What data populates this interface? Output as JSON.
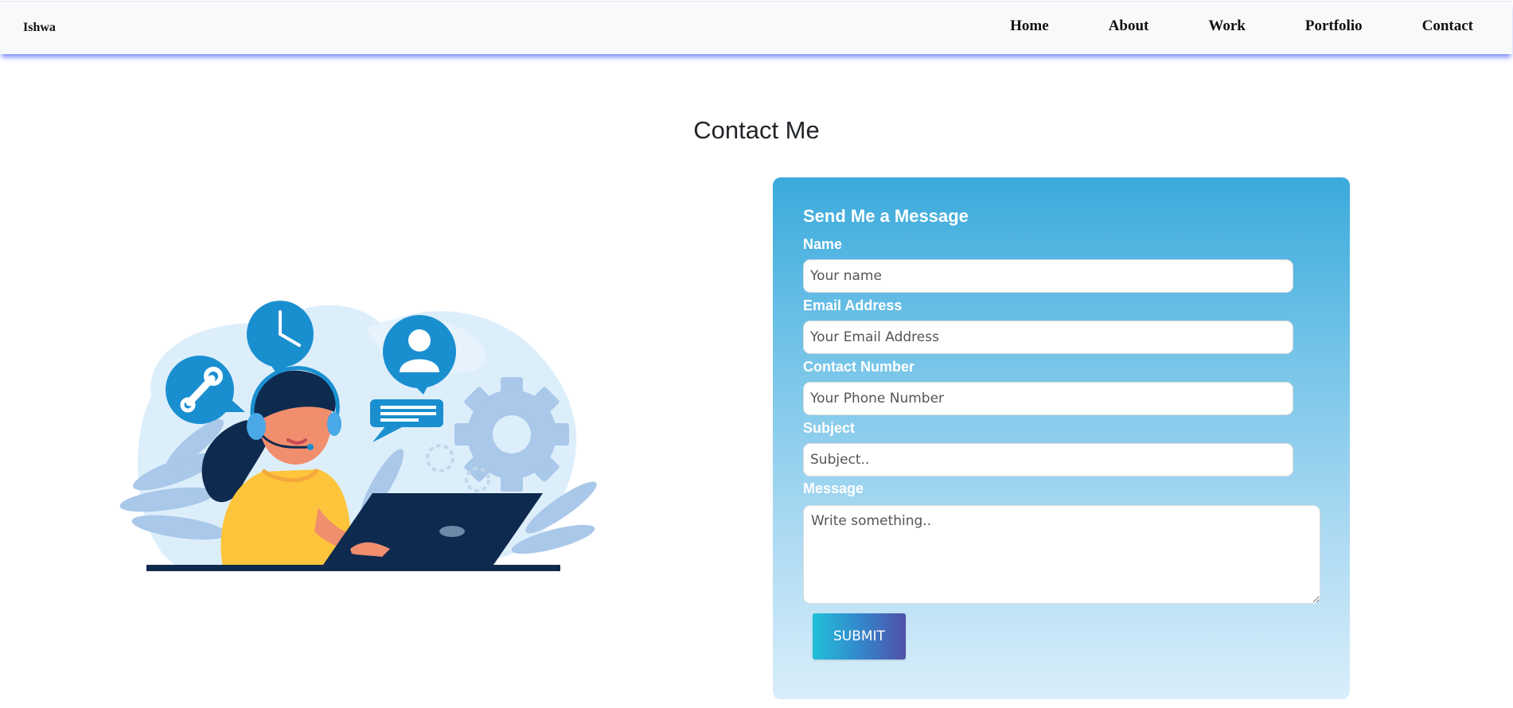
{
  "nav": {
    "brand": "Ishwa",
    "links": [
      "Home",
      "About",
      "Work",
      "Portfolio",
      "Contact"
    ]
  },
  "page": {
    "title": "Contact Me"
  },
  "illustration": {
    "icon": "customer-support-illustration"
  },
  "form": {
    "heading": "Send Me a Message",
    "name_label": "Name",
    "name_placeholder": "Your name",
    "email_label": "Email Address",
    "email_placeholder": "Your Email Address",
    "phone_label": "Contact Number",
    "phone_placeholder": "Your Phone Number",
    "subject_label": "Subject",
    "subject_placeholder": "Subject..",
    "message_label": "Message",
    "message_placeholder": "Write something..",
    "submit_label": "SUBMIT"
  },
  "colors": {
    "nav_shadow": "#5069fa",
    "card_top": "#3aaadc",
    "card_bottom": "#d9eefa",
    "button_start": "#22c0d8",
    "button_end": "#5050a8"
  }
}
